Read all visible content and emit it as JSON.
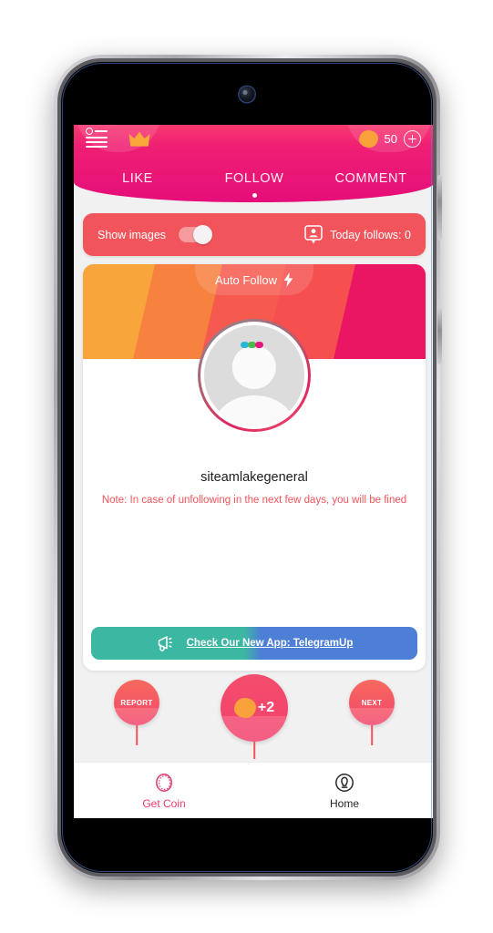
{
  "device": {
    "name": "android-phone-mockup",
    "camera": "front-camera"
  },
  "header": {
    "menu_icon": "list-menu-icon",
    "crown_icon": "crown-icon",
    "coin_icon": "coin-icon",
    "coin_count": "50",
    "add_coin_icon": "plus-circle-icon",
    "tabs": [
      {
        "label": "LIKE",
        "active": false
      },
      {
        "label": "FOLLOW",
        "active": true
      },
      {
        "label": "COMMENT",
        "active": false
      }
    ],
    "active_tab_indicator": "page-dot"
  },
  "options_bar": {
    "show_images_label": "Show images",
    "toggle_state": "on",
    "follows_icon": "person-card-icon",
    "today_follows_label": "Today follows: 0"
  },
  "card": {
    "banner": {
      "mode_label": "Auto Follow",
      "bolt_icon": "lightning-bolt-icon"
    },
    "avatar": {
      "icon": "avatar-placeholder-icon"
    },
    "username": "siteamlakegeneral",
    "note": "Note: In case of unfollowing in the next few days, you will be fined",
    "promo": {
      "icon": "megaphone-icon",
      "label": "Check Our New App: TelegramUp"
    }
  },
  "actions": {
    "report_label": "REPORT",
    "reward_label": "+2",
    "reward_icon": "coin-icon",
    "next_label": "NEXT"
  },
  "bottom_nav": [
    {
      "label": "Get Coin",
      "icon": "coin-outline-icon",
      "active": true
    },
    {
      "label": "Home",
      "icon": "person-circle-icon",
      "active": false
    }
  ],
  "colors": {
    "brand_pink": "#e50e79",
    "accent_pink": "#ef3a6d",
    "salmon": "#f2545b",
    "coin_orange": "#f9a13a",
    "teal": "#3cb7a2",
    "blue": "#4d7fd6"
  }
}
